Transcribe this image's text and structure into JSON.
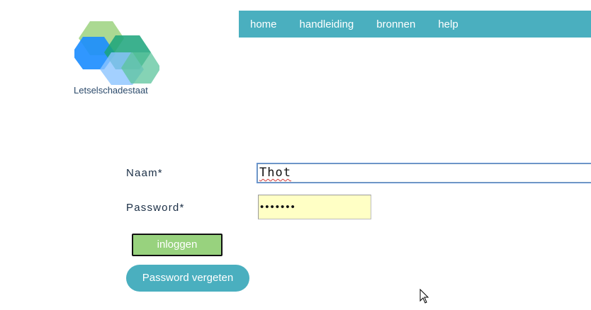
{
  "logo": {
    "text": "Letselschadestaat",
    "colors": [
      "#8fcc6d",
      "#1a8cff",
      "#1aa37a",
      "#8cc4ff",
      "#5cc49c"
    ]
  },
  "nav": {
    "color": "#4aafbf",
    "items": [
      {
        "label": "home"
      },
      {
        "label": "handleiding"
      },
      {
        "label": "bronnen"
      },
      {
        "label": "help"
      }
    ]
  },
  "form": {
    "naam_label": "Naam*",
    "naam_value": "Thot",
    "password_label": "Password*",
    "password_value": "•••••••",
    "login_label": "inloggen",
    "forgot_label": "Password vergeten"
  },
  "colors": {
    "accent": "#4aafbf",
    "login_button": "#98d27e",
    "password_field": "#ffffc5"
  },
  "icons": {
    "cursor": "mouse-pointer-icon"
  }
}
